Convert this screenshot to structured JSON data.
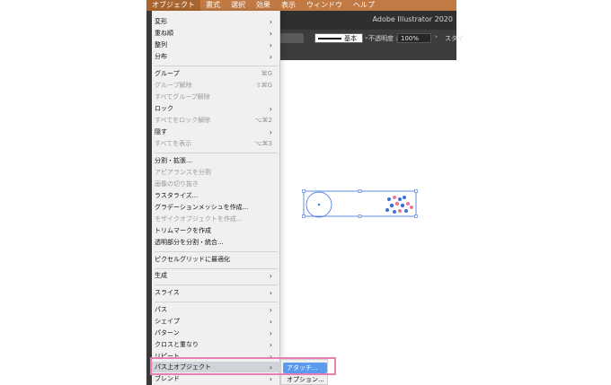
{
  "menubar": {
    "items": [
      {
        "label": "オブジェクト",
        "active": true
      },
      {
        "label": "書式"
      },
      {
        "label": "選択"
      },
      {
        "label": "効果"
      },
      {
        "label": "表示"
      },
      {
        "label": "ウィンドウ"
      },
      {
        "label": "ヘルプ"
      }
    ]
  },
  "window": {
    "title": "Adobe Illustrator 2020"
  },
  "controlbar": {
    "stroke_label": "基本",
    "opacity_label": "不透明度 :",
    "opacity_value": "100%",
    "style_label": "スタイ"
  },
  "menu": {
    "items": [
      {
        "label": "変形",
        "submenu": true
      },
      {
        "label": "重ね順",
        "submenu": true
      },
      {
        "label": "整列",
        "submenu": true
      },
      {
        "label": "分布",
        "submenu": true
      },
      {
        "label": "グループ",
        "shortcut": "⌘G"
      },
      {
        "label": "グループ解除",
        "shortcut": "⇧⌘G",
        "disabled": true
      },
      {
        "label": "すべてグループ解除",
        "disabled": true
      },
      {
        "label": "ロック",
        "submenu": true
      },
      {
        "label": "すべてをロック解除",
        "shortcut": "⌥⌘2",
        "disabled": true
      },
      {
        "label": "隠す",
        "submenu": true
      },
      {
        "label": "すべてを表示",
        "shortcut": "⌥⌘3",
        "disabled": true
      },
      {
        "label": "分割・拡張..."
      },
      {
        "label": "アピアランスを分割",
        "disabled": true
      },
      {
        "label": "画像の切り抜き",
        "disabled": true
      },
      {
        "label": "ラスタライズ..."
      },
      {
        "label": "グラデーションメッシュを作成..."
      },
      {
        "label": "モザイクオブジェクトを作成...",
        "disabled": true
      },
      {
        "label": "トリムマークを作成"
      },
      {
        "label": "透明部分を分割・統合..."
      },
      {
        "label": "ピクセルグリッドに最適化"
      },
      {
        "label": "生成",
        "submenu": true
      },
      {
        "label": "スライス",
        "submenu": true
      },
      {
        "label": "パス",
        "submenu": true
      },
      {
        "label": "シェイプ",
        "submenu": true
      },
      {
        "label": "パターン",
        "submenu": true
      },
      {
        "label": "クロスと重なり",
        "submenu": true
      },
      {
        "label": "リピート",
        "submenu": true
      },
      {
        "label": "パス上オブジェクト",
        "submenu": true,
        "highlighted": true
      },
      {
        "label": "ブレンド",
        "submenu": true
      }
    ]
  },
  "submenu": {
    "items": [
      {
        "label": "アタッチ...",
        "selected": true
      },
      {
        "label": "オプション..."
      }
    ]
  },
  "colors": {
    "menubar": "#c17a43",
    "highlight_frame": "#e77fb3",
    "submenu_selected": "#5a9bf0",
    "selection": "#3c6fd8",
    "accent_pink": "#e8789a"
  }
}
